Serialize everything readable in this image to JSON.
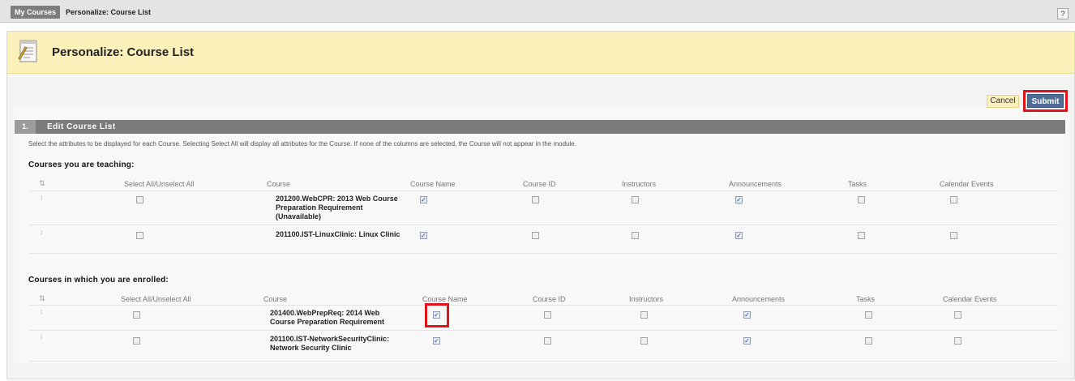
{
  "breadcrumb": {
    "home": "My Courses",
    "current": "Personalize: Course List"
  },
  "help": {
    "label": "?"
  },
  "page": {
    "title": "Personalize: Course List"
  },
  "actions": {
    "cancel": "Cancel",
    "submit": "Submit"
  },
  "section": {
    "number": "1.",
    "title": "Edit Course List",
    "instructions": "Select the attributes to be displayed for each Course. Selecting Select All will display all attributes for the Course. If none of the columns are selected, the Course will not appear in the module."
  },
  "columns": [
    "Select All/Unselect All",
    "Course",
    "Course Name",
    "Course ID",
    "Instructors",
    "Announcements",
    "Tasks",
    "Calendar Events"
  ],
  "teaching": {
    "heading": "Courses you are teaching:",
    "rows": [
      {
        "course": "201200.WebCPR: 2013 Web Course Preparation Requirement (Unavailable)",
        "select_all": false,
        "course_name": true,
        "course_id": false,
        "instructors": false,
        "announcements": true,
        "tasks": false,
        "calendar_events": false
      },
      {
        "course": "201100.IST-LinuxClinic: Linux Clinic",
        "select_all": false,
        "course_name": true,
        "course_id": false,
        "instructors": false,
        "announcements": true,
        "tasks": false,
        "calendar_events": false
      }
    ]
  },
  "enrolled": {
    "heading": "Courses in which you are enrolled:",
    "rows": [
      {
        "course": "201400.WebPrepReq: 2014 Web Course Preparation Requirement",
        "select_all": false,
        "course_name": true,
        "course_id": false,
        "instructors": false,
        "announcements": true,
        "tasks": false,
        "calendar_events": false
      },
      {
        "course": "201100.IST-NetworkSecurityClinic: Network Security Clinic",
        "select_all": false,
        "course_name": true,
        "course_id": false,
        "instructors": false,
        "announcements": true,
        "tasks": false,
        "calendar_events": false
      }
    ]
  },
  "colors": {
    "highlight": "#e0131b",
    "title_bg": "#fcf0bb",
    "submit_bg": "#4e6d96"
  },
  "icons": {
    "sort": "sort-arrows-icon",
    "drag": "drag-handle-icon",
    "page": "notepad-icon"
  }
}
